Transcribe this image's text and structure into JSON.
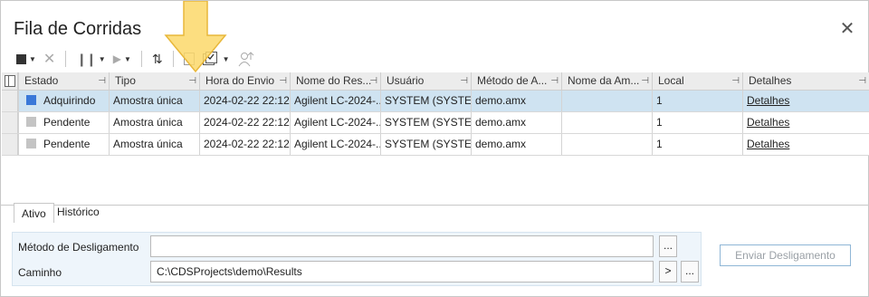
{
  "window": {
    "title": "Fila de Corridas"
  },
  "columns": [
    {
      "label": "Estado"
    },
    {
      "label": "Tipo"
    },
    {
      "label": "Hora do Envio"
    },
    {
      "label": "Nome do Res..."
    },
    {
      "label": "Usuário"
    },
    {
      "label": "Método de A..."
    },
    {
      "label": "Nome da Am..."
    },
    {
      "label": "Local"
    },
    {
      "label": "Detalhes"
    }
  ],
  "rows": [
    {
      "estado": "Adquirindo",
      "status_color": "#3a78d8",
      "tipo": "Amostra única",
      "hora": "2024-02-22 22:12...",
      "nome_res": "Agilent LC-2024-...",
      "usuario": "SYSTEM (SYSTEM)",
      "metodo": "demo.amx",
      "nome_am": "",
      "local": "1",
      "detalhes": "Detalhes"
    },
    {
      "estado": "Pendente",
      "status_color": "#c4c4c4",
      "tipo": "Amostra única",
      "hora": "2024-02-22 22:12...",
      "nome_res": "Agilent LC-2024-...",
      "usuario": "SYSTEM (SYSTEM)",
      "metodo": "demo.amx",
      "nome_am": "",
      "local": "1",
      "detalhes": "Detalhes"
    },
    {
      "estado": "Pendente",
      "status_color": "#c4c4c4",
      "tipo": "Amostra única",
      "hora": "2024-02-22 22:12...",
      "nome_res": "Agilent LC-2024-...",
      "usuario": "SYSTEM (SYSTEM)",
      "metodo": "demo.amx",
      "nome_am": "",
      "local": "1",
      "detalhes": "Detalhes"
    }
  ],
  "tabs": [
    {
      "label": "Ativo"
    },
    {
      "label": "Histórico"
    }
  ],
  "form": {
    "metodo_label": "Método de Desligamento",
    "metodo_value": "",
    "caminho_label": "Caminho",
    "caminho_value": "C:\\CDSProjects\\demo\\Results",
    "browse": "...",
    "arrow": ">"
  },
  "send_button": "Enviar Desligamento",
  "colors": {
    "selected_row": "#cfe3f1",
    "highlight_arrow": "#fbd86a"
  }
}
